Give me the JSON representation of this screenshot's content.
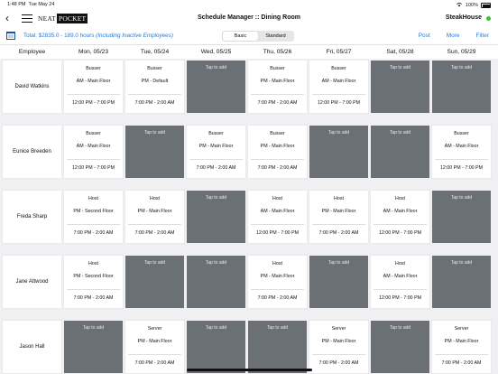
{
  "status_bar": {
    "time": "1:48 PM",
    "date": "Tue May 24",
    "battery": "100%"
  },
  "nav": {
    "back_icon": "chevron-left",
    "menu_icon": "hamburger",
    "logo_text_a": "NEAT",
    "logo_text_b": "POCKET",
    "title": "Schedule Manager :: Dining Room",
    "venue": "SteakHouse",
    "venue_status_color": "#3dbb3d"
  },
  "toolbar": {
    "calendar_icon": "calendar",
    "total_main": "Total: $2835.0 - 189.0 hours",
    "total_note": "(Including Inactive Employees)",
    "view_modes": [
      "Basic",
      "Standard"
    ],
    "active_view": "Basic",
    "actions": [
      "Post",
      "More",
      "Filter"
    ]
  },
  "header": {
    "employee_label": "Employee",
    "days": [
      "Mon, 05/23",
      "Tue, 05/24",
      "Wed, 05/25",
      "Thu, 05/26",
      "Fri, 05/27",
      "Sat, 05/28",
      "Sun, 05/29"
    ]
  },
  "colors": {
    "accent": "#2a7bd8",
    "empty_slot": "#6b7075"
  },
  "empty_label": "Tap to add",
  "rows": [
    {
      "name": "David Watkins",
      "shifts": [
        {
          "role": "Busser",
          "area": "AM - Main Floor",
          "time": "12:00 PM - 7:00 PM"
        },
        {
          "role": "Busser",
          "area": "PM - Default",
          "time": "7:00 PM - 2:00 AM"
        },
        null,
        {
          "role": "Busser",
          "area": "PM - Main Floor",
          "time": "7:00 PM - 2:00 AM"
        },
        {
          "role": "Busser",
          "area": "AM - Main Floor",
          "time": "12:00 PM - 7:00 PM"
        },
        null,
        null
      ]
    },
    {
      "name": "Eunice Breeden",
      "shifts": [
        {
          "role": "Busser",
          "area": "AM - Main Floor",
          "time": "12:00 PM - 7:00 PM"
        },
        null,
        {
          "role": "Busser",
          "area": "PM - Main Floor",
          "time": "7:00 PM - 2:00 AM"
        },
        {
          "role": "Busser",
          "area": "PM - Main Floor",
          "time": "7:00 PM - 2:00 AM"
        },
        null,
        null,
        {
          "role": "Busser",
          "area": "AM - Main Floor",
          "time": "12:00 PM - 7:00 PM"
        }
      ]
    },
    {
      "name": "Freda Sharp",
      "shifts": [
        {
          "role": "Host",
          "area": "PM - Second Floor",
          "time": "7:00 PM - 2:00 AM"
        },
        {
          "role": "Host",
          "area": "PM - Main Floor",
          "time": "7:00 PM - 2:00 AM"
        },
        null,
        {
          "role": "Host",
          "area": "AM - Main Floor",
          "time": "12:00 PM - 7:00 PM"
        },
        {
          "role": "Host",
          "area": "PM - Main Floor",
          "time": "7:00 PM - 2:00 AM"
        },
        {
          "role": "Host",
          "area": "AM - Main Floor",
          "time": "12:00 PM - 7:00 PM"
        },
        null
      ]
    },
    {
      "name": "Jane Attwood",
      "shifts": [
        {
          "role": "Host",
          "area": "PM - Second Floor",
          "time": "7:00 PM - 2:00 AM"
        },
        null,
        null,
        {
          "role": "Host",
          "area": "PM - Main Floor",
          "time": "7:00 PM - 2:00 AM"
        },
        null,
        {
          "role": "Host",
          "area": "AM - Main Floor",
          "time": "12:00 PM - 7:00 PM"
        },
        null
      ]
    },
    {
      "name": "Jason Hall",
      "shifts": [
        null,
        {
          "role": "Server",
          "area": "PM - Main Floor",
          "time": "7:00 PM - 2:00 AM"
        },
        null,
        null,
        {
          "role": "Server",
          "area": "PM - Main Floor",
          "time": "7:00 PM - 2:00 AM"
        },
        null,
        {
          "role": "Server",
          "area": "PM - Main Floor",
          "time": "7:00 PM - 2:00 AM"
        }
      ]
    }
  ]
}
